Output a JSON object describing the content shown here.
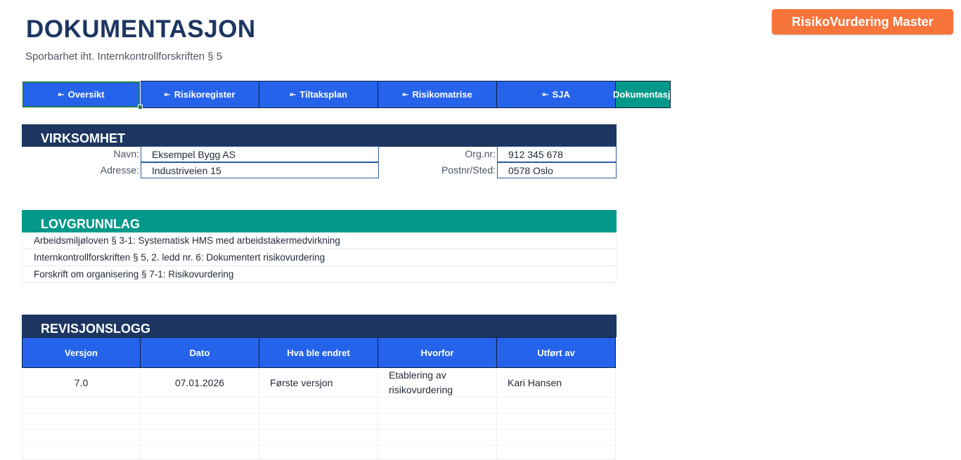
{
  "header": {
    "title": "DOKUMENTASJON",
    "subtitle": "Sporbarhet iht. Internkontrollforskriften § 5",
    "master_button": "RisikoVurdering Master"
  },
  "nav": {
    "arrow": "⇤",
    "tabs": [
      "Oversikt",
      "Risikoregister",
      "Tiltaksplan",
      "Risikomatrise",
      "SJA",
      "Dokumentasjon"
    ]
  },
  "virksomhet": {
    "heading": "VIRKSOMHET",
    "name_label": "Navn:",
    "name_value": "Eksempel Bygg AS",
    "address_label": "Adresse:",
    "address_value": "Industriveien 15",
    "orgnr_label": "Org.nr:",
    "orgnr_value": "912 345 678",
    "postnr_label": "Postnr/Sted:",
    "postnr_value": "0578 Oslo"
  },
  "lovgrunnlag": {
    "heading": "LOVGRUNNLAG",
    "items": [
      "Arbeidsmiljøloven § 3-1: Systematisk HMS med arbeidstakermedvirkning",
      "Internkontrollforskriften § 5, 2. ledd nr. 6: Dokumentert risikovurdering",
      "Forskrift om organisering § 7-1: Risikovurdering"
    ]
  },
  "revisjonslogg": {
    "heading": "REVISJONSLOGG",
    "columns": [
      "Versjon",
      "Dato",
      "Hva ble endret",
      "Hvorfor",
      "Utført av"
    ],
    "rows": [
      [
        "7.0",
        "07.01.2026",
        "Første versjon",
        "Etablering av risikovurdering",
        "Kari Hansen"
      ]
    ]
  }
}
